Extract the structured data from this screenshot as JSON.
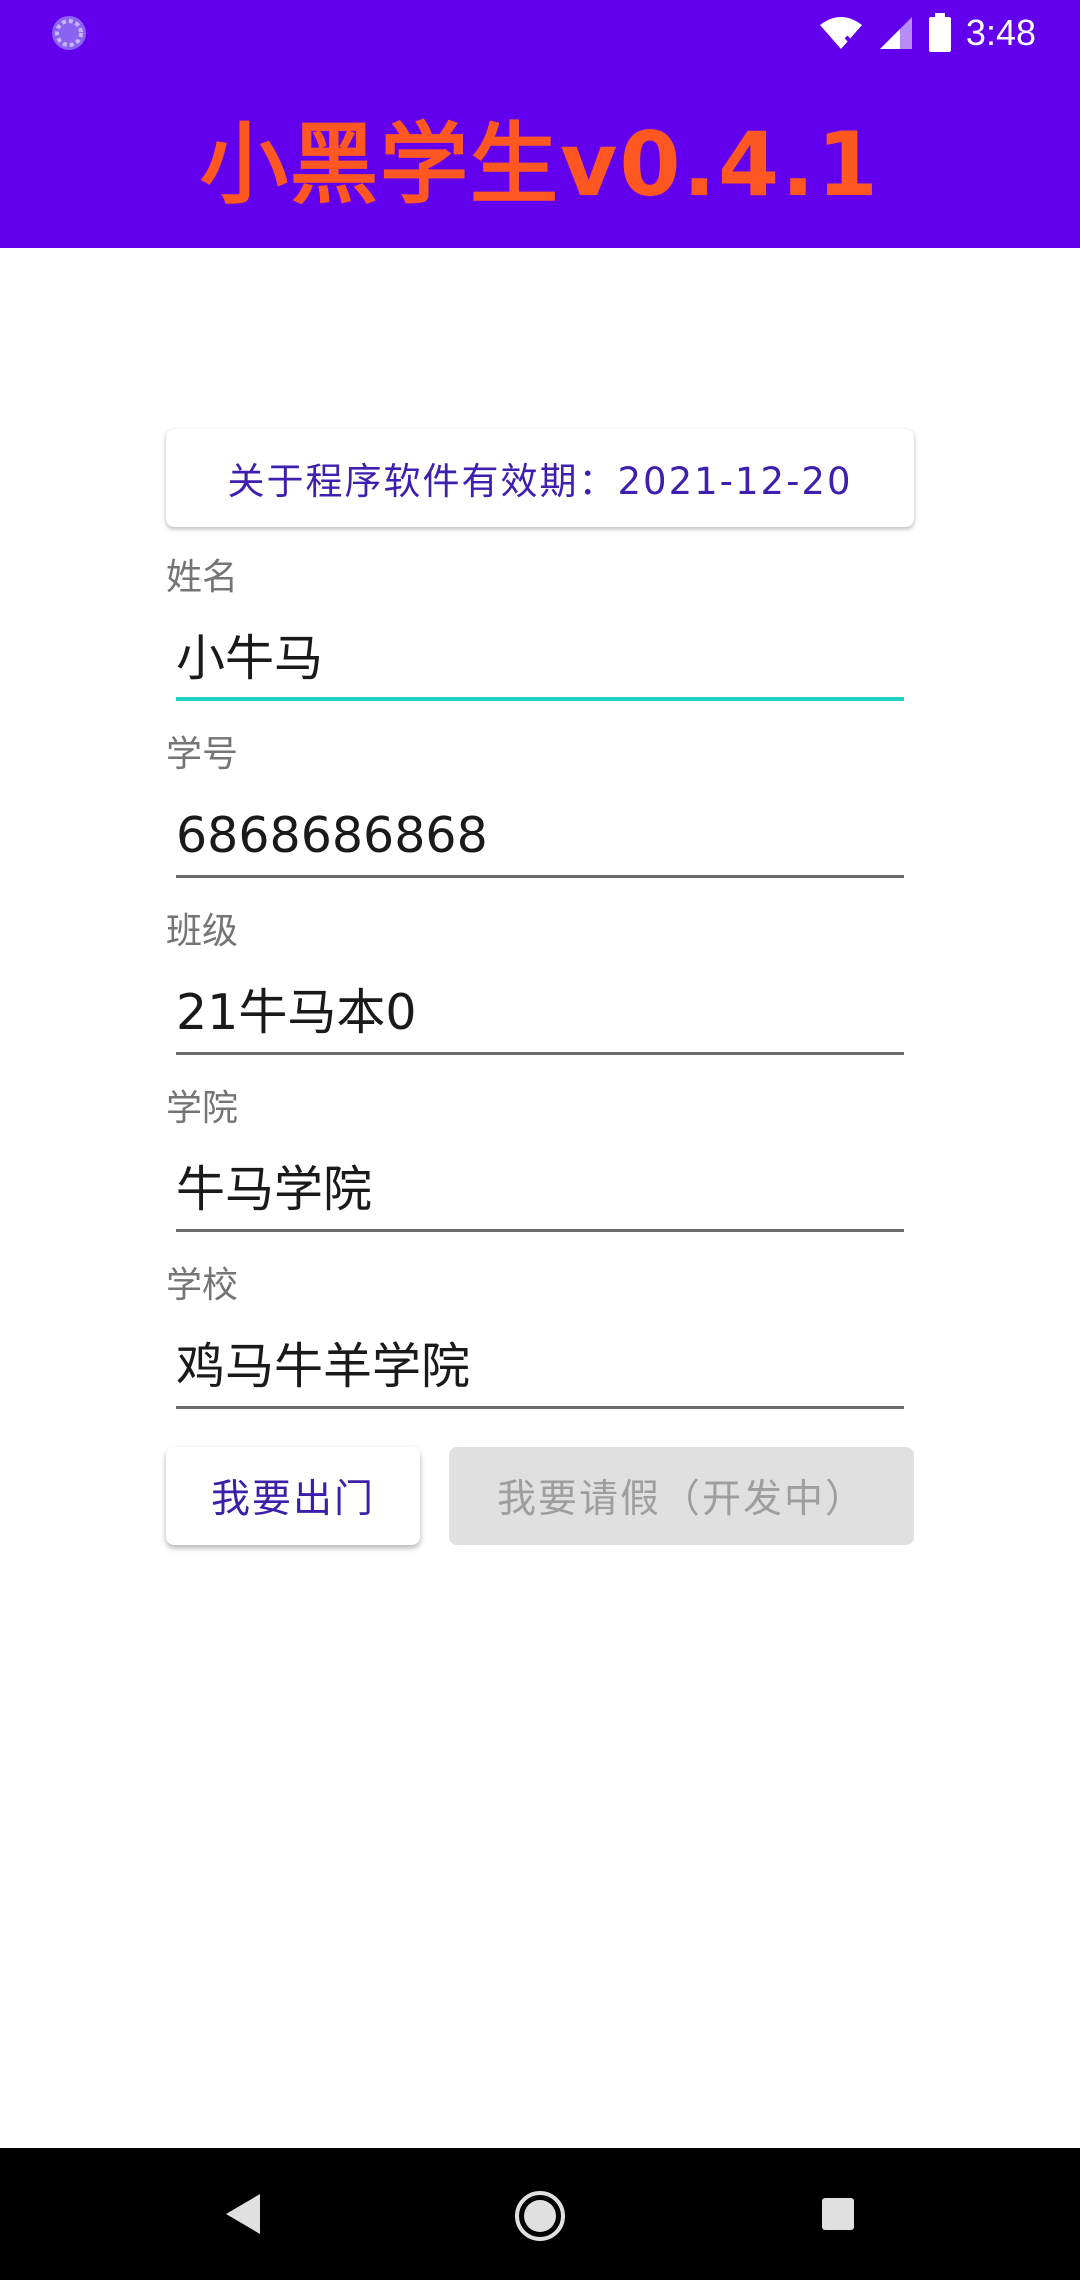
{
  "status_bar": {
    "time": "3:48",
    "icons": [
      "sync-icon",
      "wifi-icon",
      "signal-icon",
      "battery-icon"
    ],
    "background": "#6200EE"
  },
  "app_bar": {
    "title": "小黑学生v0.4.1",
    "title_color": "#FF5722",
    "background": "#6200EE"
  },
  "validity": {
    "text": "关于程序软件有效期：2021-12-20"
  },
  "form": {
    "name": {
      "label": "姓名",
      "value": "小牛马"
    },
    "student_id": {
      "label": "学号",
      "value": "6868686868"
    },
    "class": {
      "label": "班级",
      "value": "21牛马本0"
    },
    "college": {
      "label": "学院",
      "value": "牛马学院"
    },
    "school": {
      "label": "学校",
      "value": "鸡马牛羊学院"
    }
  },
  "buttons": {
    "go_out": "我要出门",
    "leave": "我要请假（开发中）"
  },
  "nav_bar": {
    "icons": [
      "back-icon",
      "home-icon",
      "recents-icon"
    ]
  }
}
